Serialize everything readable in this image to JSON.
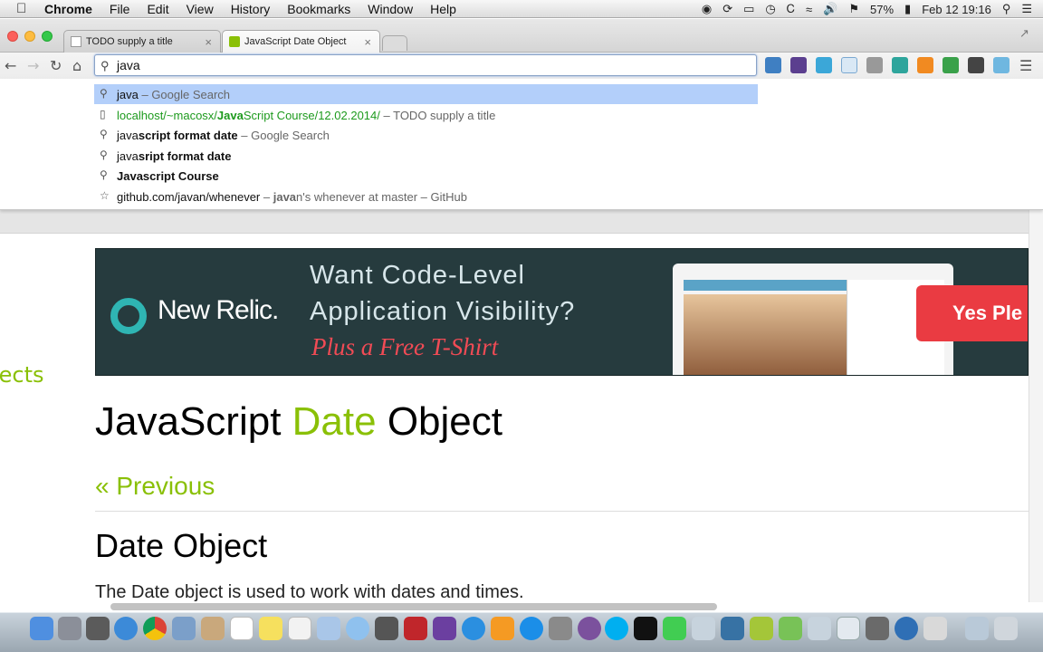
{
  "menubar": {
    "app": "Chrome",
    "items": [
      "File",
      "Edit",
      "View",
      "History",
      "Bookmarks",
      "Window",
      "Help"
    ],
    "battery": "57%",
    "datetime": "Feb 12  19:16"
  },
  "tabs": [
    {
      "title": "TODO supply a title",
      "active": false
    },
    {
      "title": "JavaScript Date Object",
      "active": true
    }
  ],
  "omnibox": {
    "value": "java"
  },
  "suggestions": [
    {
      "icon": "search-icon",
      "parts": [
        [
          "b",
          ""
        ],
        [
          "t",
          "java"
        ],
        [
          "d",
          " – Google Search"
        ]
      ]
    },
    {
      "icon": "page-icon",
      "parts": [
        [
          "u",
          "localhost/~macosx/"
        ],
        [
          "ub",
          "Java"
        ],
        [
          "u",
          "Script Course/12.02.2014/"
        ],
        [
          "d",
          " – TODO supply a title"
        ]
      ]
    },
    {
      "icon": "search-icon",
      "parts": [
        [
          "t",
          "java"
        ],
        [
          "b",
          "script format date"
        ],
        [
          "d",
          " – Google Search"
        ]
      ]
    },
    {
      "icon": "search-icon",
      "parts": [
        [
          "t",
          "java"
        ],
        [
          "b",
          "sript format date"
        ]
      ]
    },
    {
      "icon": "search-icon",
      "parts": [
        [
          "b",
          "Java"
        ],
        [
          "b",
          "script Course"
        ]
      ]
    },
    {
      "icon": "star-icon",
      "parts": [
        [
          "t",
          "github.com/javan/whenever"
        ],
        [
          "d",
          " – "
        ],
        [
          "db",
          "java"
        ],
        [
          "d",
          "n's whenever at master – GitHub"
        ]
      ]
    }
  ],
  "page": {
    "side_link": "jects",
    "banner": {
      "logo": "New Relic.",
      "line1": "Want Code-Level",
      "line2": "Application Visibility?",
      "line3": "Plus a Free T-Shirt",
      "button": "Yes Ple"
    },
    "title_pre": "JavaScript ",
    "title_hl": "Date",
    "title_post": " Object",
    "previous": "« Previous",
    "section_title": "Date Object",
    "paragraph": "The Date object is used to work with dates and times."
  },
  "colors": {
    "accent_green": "#8ac007",
    "url_green": "#1d9a1d",
    "suggestion_highlight": "#b3cffa",
    "banner_bg": "#263b3e",
    "banner_red": "#ea3b42"
  }
}
